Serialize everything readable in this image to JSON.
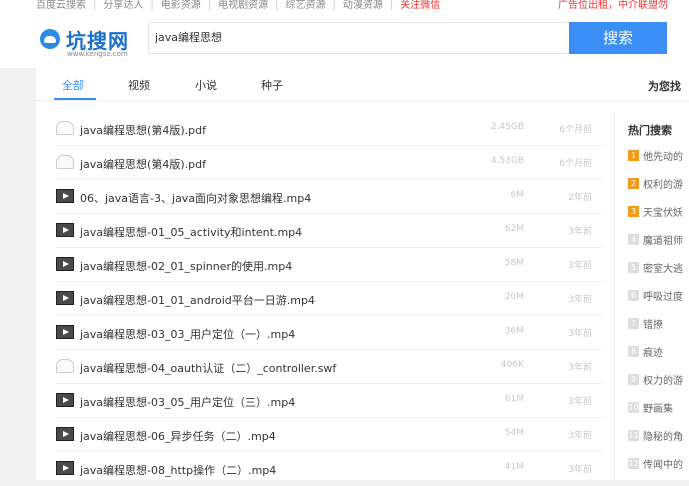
{
  "topnav": {
    "links": [
      "百度云搜索",
      "分享达人",
      "电影资源",
      "电视剧资源",
      "综艺资源",
      "动漫资源"
    ],
    "highlight": "关注微信",
    "ad": "广告位出租，中介联盟勿"
  },
  "logo": {
    "name": "坑搜网",
    "url_text": "www.kengso.com"
  },
  "search": {
    "query": "java编程思想",
    "button": "搜索"
  },
  "tabs": {
    "items": [
      "全部",
      "视频",
      "小说",
      "种子"
    ],
    "right_text": "为您找"
  },
  "results": [
    {
      "type": "cloud",
      "name": "java编程思想(第4版).pdf",
      "size": "2.45GB",
      "time": "6个月前"
    },
    {
      "type": "cloud",
      "name": "java编程思想(第4版).pdf",
      "size": "4.53GB",
      "time": "6个月前"
    },
    {
      "type": "video",
      "name": "06、java语言-3、java面向对象思想编程.mp4",
      "size": "6M",
      "time": "2年前"
    },
    {
      "type": "video",
      "name": "java编程思想-01_05_activity和intent.mp4",
      "size": "62M",
      "time": "3年前"
    },
    {
      "type": "video",
      "name": "java编程思想-02_01_spinner的使用.mp4",
      "size": "58M",
      "time": "3年前"
    },
    {
      "type": "video",
      "name": "java编程思想-01_01_android平台一日游.mp4",
      "size": "20M",
      "time": "3年前"
    },
    {
      "type": "video",
      "name": "java编程思想-03_03_用户定位（一）.mp4",
      "size": "36M",
      "time": "3年前"
    },
    {
      "type": "cloud",
      "name": "java编程思想-04_oauth认证（二）_controller.swf",
      "size": "406K",
      "time": "3年前"
    },
    {
      "type": "video",
      "name": "java编程思想-03_05_用户定位（三）.mp4",
      "size": "61M",
      "time": "3年前"
    },
    {
      "type": "video",
      "name": "java编程思想-06_异步任务（二）.mp4",
      "size": "54M",
      "time": "3年前"
    },
    {
      "type": "video",
      "name": "java编程思想-08_http操作（二）.mp4",
      "size": "41M",
      "time": "3年前"
    }
  ],
  "sidebar": {
    "title": "热门搜索",
    "items": [
      {
        "num": "1",
        "text": "他先动的"
      },
      {
        "num": "2",
        "text": "权利的游"
      },
      {
        "num": "3",
        "text": "天宝伏妖"
      },
      {
        "num": "4",
        "text": "魔道祖师"
      },
      {
        "num": "5",
        "text": "密室大逃"
      },
      {
        "num": "6",
        "text": "呼吸过度"
      },
      {
        "num": "7",
        "text": "错撩"
      },
      {
        "num": "8",
        "text": "痕迹"
      },
      {
        "num": "9",
        "text": "权力的游"
      },
      {
        "num": "10",
        "text": "野画集"
      },
      {
        "num": "11",
        "text": "隐秘的角"
      },
      {
        "num": "12",
        "text": "传闻中的"
      }
    ]
  }
}
